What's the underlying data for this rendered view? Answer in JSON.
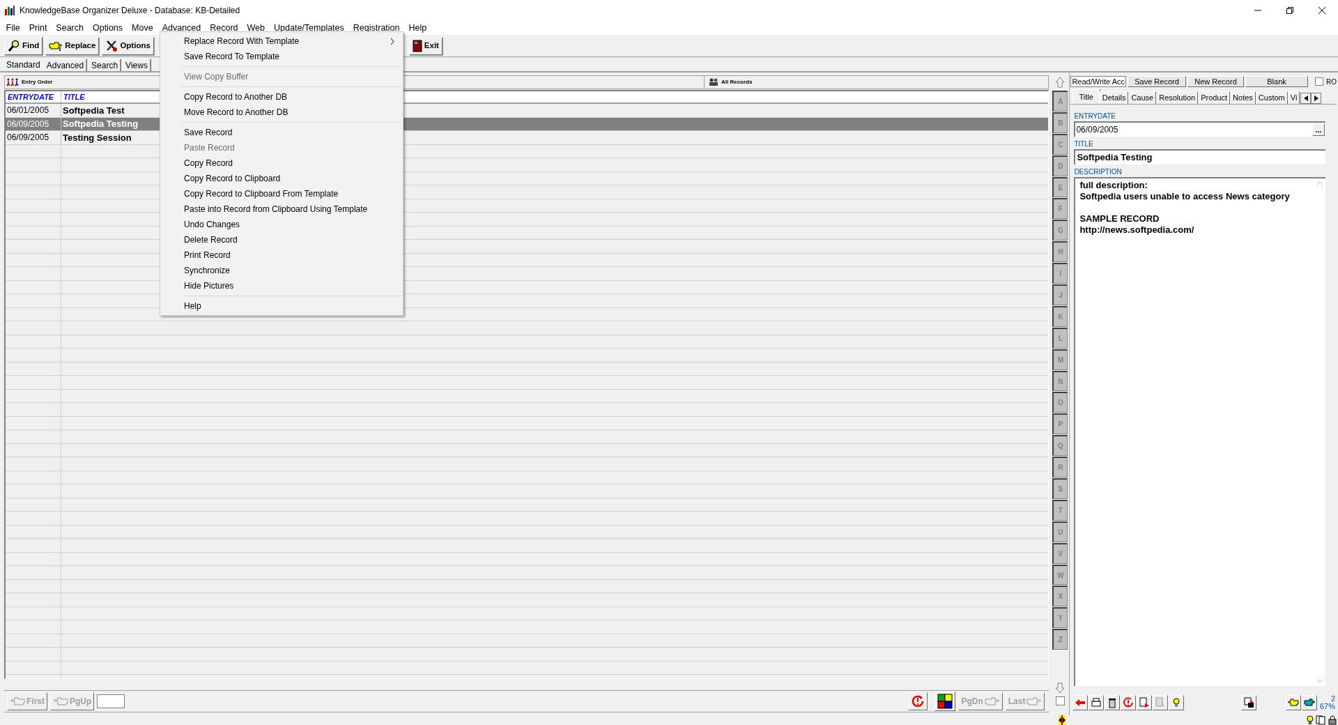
{
  "window": {
    "title": "KnowledgeBase Organizer Deluxe - Database: KB-Detailed"
  },
  "menu_bar": [
    "File",
    "Print",
    "Search",
    "Options",
    "Move",
    "Advanced",
    "Record",
    "Web",
    "Update/Templates",
    "Registration",
    "Help"
  ],
  "toolbar": [
    {
      "label": "Find"
    },
    {
      "label": "Replace"
    },
    {
      "label": "Options"
    },
    {
      "label": "Exit"
    }
  ],
  "view_tabs": [
    {
      "label": "Standard",
      "selected": true
    },
    {
      "label": "Advanced",
      "selected": false
    },
    {
      "label": "Search",
      "selected": false
    },
    {
      "label": "Views",
      "selected": false
    }
  ],
  "grid": {
    "sort_label": "Entry Order",
    "filter_label": "All Records",
    "columns": [
      "ENTRYDATE",
      "TITLE"
    ],
    "rows": [
      {
        "cells": [
          "06/01/2005",
          "Softpedia Test"
        ],
        "selected": false
      },
      {
        "cells": [
          "06/09/2005",
          "Softpedia Testing"
        ],
        "selected": true
      },
      {
        "cells": [
          "06/09/2005",
          "Testing Session"
        ],
        "selected": false
      }
    ]
  },
  "dropdown_menu": {
    "groups": [
      [
        {
          "label": "Replace Record With Template",
          "disabled": false,
          "submenu": true
        },
        {
          "label": "Save Record To Template",
          "disabled": false,
          "submenu": false
        }
      ],
      [
        {
          "label": "View Copy Buffer",
          "disabled": true,
          "submenu": false
        }
      ],
      [
        {
          "label": "Copy Record to Another DB",
          "disabled": false,
          "submenu": false
        },
        {
          "label": "Move Record to Another DB",
          "disabled": false,
          "submenu": false
        }
      ],
      [
        {
          "label": "Save Record",
          "disabled": false,
          "submenu": false
        },
        {
          "label": "Paste Record",
          "disabled": true,
          "submenu": false
        },
        {
          "label": "Copy Record",
          "disabled": false,
          "submenu": false
        },
        {
          "label": "Copy Record to Clipboard",
          "disabled": false,
          "submenu": false
        },
        {
          "label": "Copy Record to Clipboard From Template",
          "disabled": false,
          "submenu": false
        },
        {
          "label": "Paste into Record from Clipboard Using Template",
          "disabled": false,
          "submenu": false
        },
        {
          "label": "Undo Changes",
          "disabled": false,
          "submenu": false
        },
        {
          "label": "Delete Record",
          "disabled": false,
          "submenu": false
        },
        {
          "label": "Print Record",
          "disabled": false,
          "submenu": false
        },
        {
          "label": "Synchronize",
          "disabled": false,
          "submenu": false
        },
        {
          "label": "Hide Pictures",
          "disabled": false,
          "submenu": false
        }
      ],
      [
        {
          "label": "Help",
          "disabled": false,
          "submenu": false
        }
      ]
    ]
  },
  "index_checkbox": {
    "checked": false
  },
  "letter_index": [
    "A",
    "B",
    "C",
    "D",
    "E",
    "F",
    "G",
    "H",
    "I",
    "J",
    "K",
    "L",
    "M",
    "N",
    "O",
    "P",
    "Q",
    "R",
    "S",
    "T",
    "U",
    "V",
    "W",
    "X",
    "Y",
    "Z"
  ],
  "record_panel": {
    "access_label": "Read/Write Acc",
    "buttons": [
      "Save Record",
      "New Record",
      "Blank"
    ],
    "ro_checkbox": {
      "label": "RO",
      "checked": false
    },
    "tabs": [
      {
        "label": "Title",
        "selected": true
      },
      {
        "label": "Details",
        "selected": false
      },
      {
        "label": "Cause",
        "selected": false
      },
      {
        "label": "Resolution",
        "selected": false
      },
      {
        "label": "Product",
        "selected": false
      },
      {
        "label": "Notes",
        "selected": false
      },
      {
        "label": "Custom",
        "selected": false
      },
      {
        "label": "Vi",
        "selected": false
      }
    ],
    "fields": [
      {
        "label": "ENTRYDATE",
        "value": "06/09/2005",
        "kind": "date",
        "button_label": "..."
      },
      {
        "label": "TITLE",
        "value": "Softpedia Testing",
        "kind": "text"
      },
      {
        "label": "DESCRIPTION",
        "value": "full description:\nSoftpedia users unable to access News category\n\nSAMPLE RECORD\nhttp://news.softpedia.com/",
        "kind": "memo"
      }
    ],
    "record_number": "2",
    "percent": "67%"
  },
  "bottom_nav": {
    "left": [
      {
        "label": "First",
        "disabled": true
      },
      {
        "label": "PgUp",
        "disabled": true
      }
    ],
    "right": [
      {
        "label": "PgDn",
        "disabled": true
      },
      {
        "label": "Last",
        "disabled": true
      }
    ]
  }
}
